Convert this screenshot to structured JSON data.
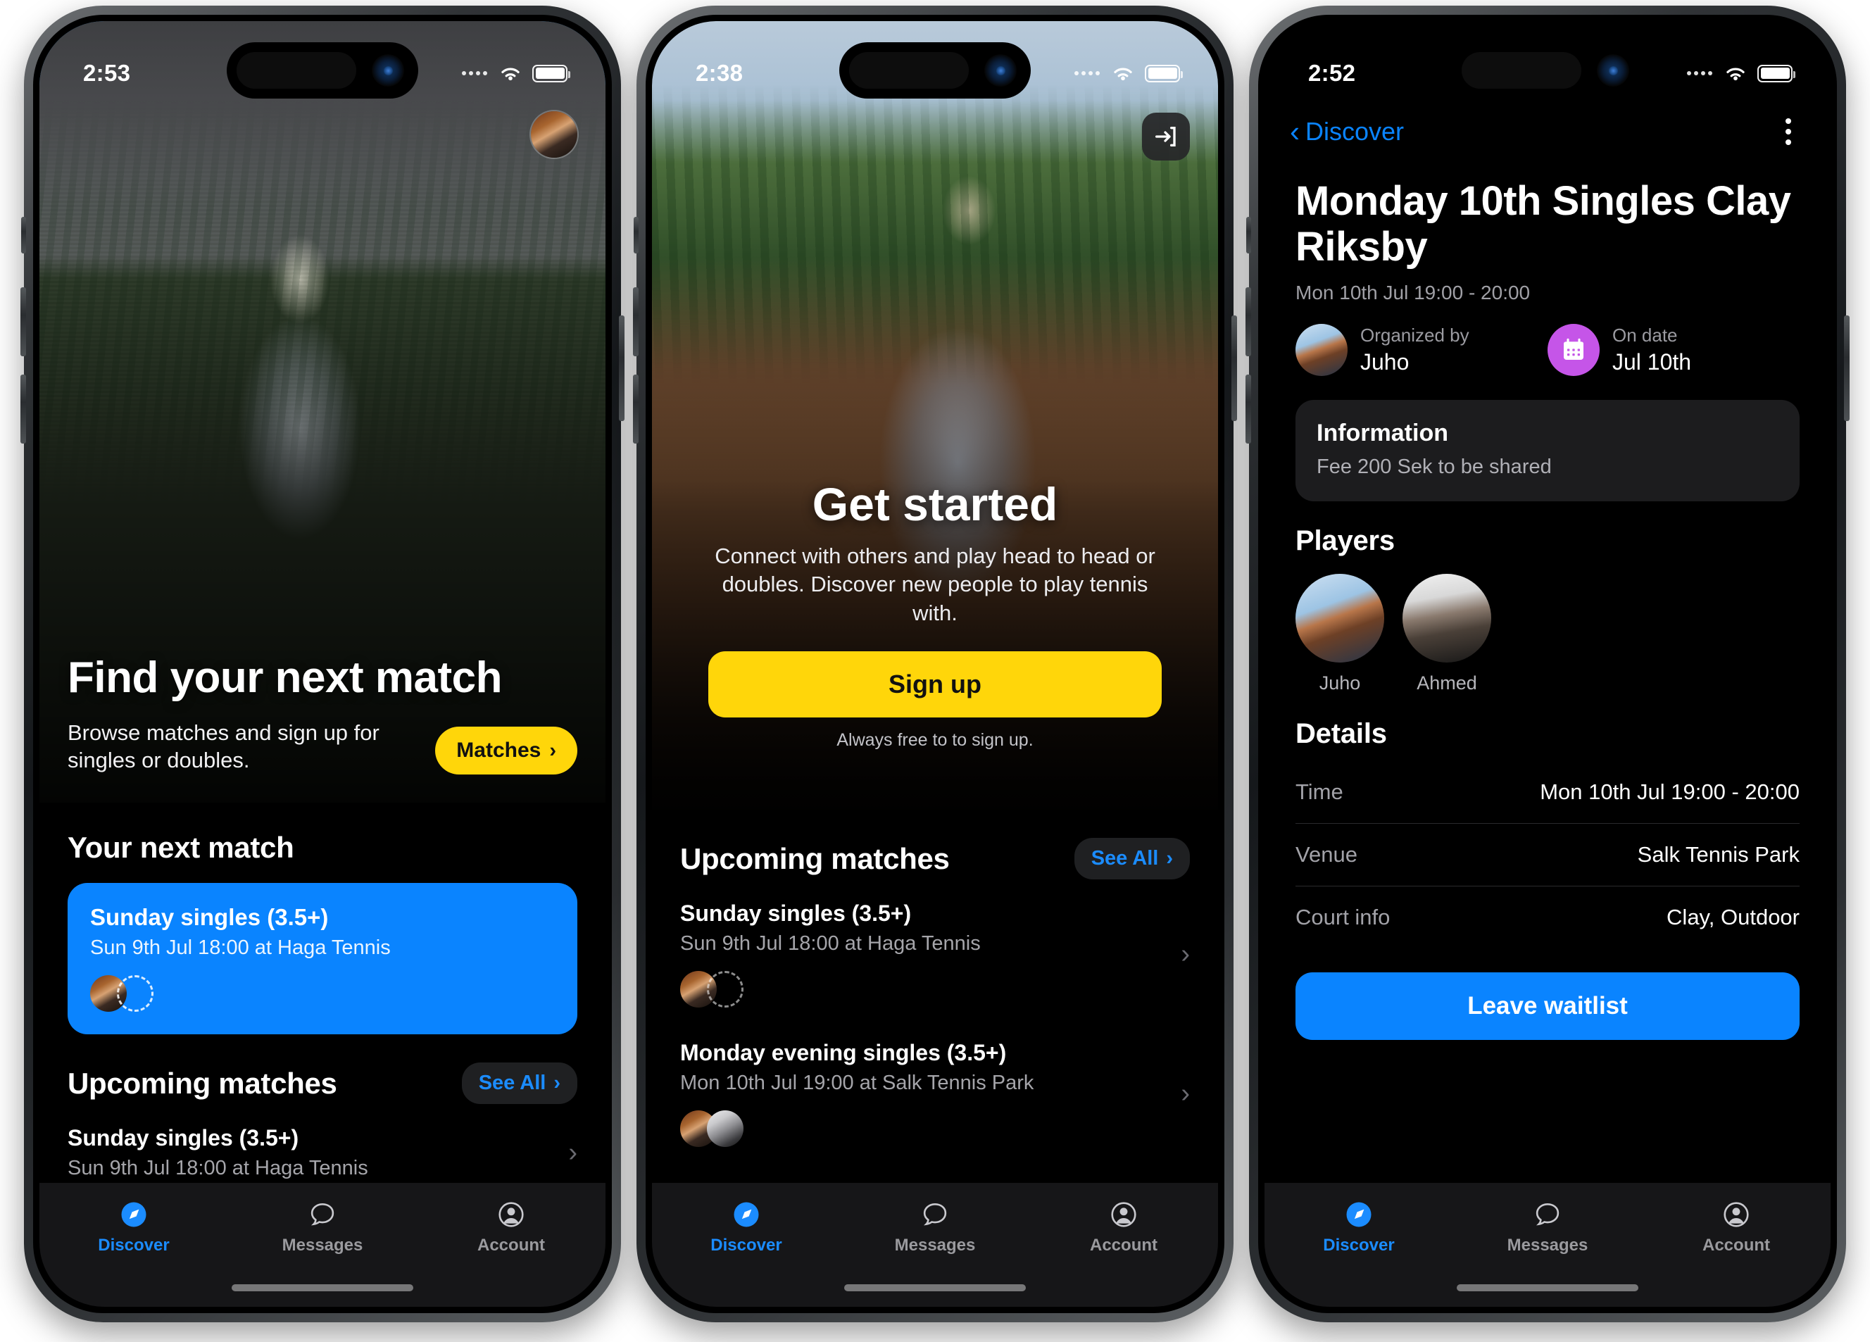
{
  "app": {
    "accent_blue": "#0a84ff",
    "accent_yellow": "#FFD60A",
    "accent_purple": "#C555E8",
    "background": "#000000"
  },
  "tabs": [
    {
      "label": "Discover",
      "icon": "compass-icon",
      "active": true
    },
    {
      "label": "Messages",
      "icon": "chat-bubble-icon",
      "active": false
    },
    {
      "label": "Account",
      "icon": "person-circle-icon",
      "active": false
    }
  ],
  "phone1": {
    "status": {
      "time": "2:53",
      "wifi": "wifi-icon",
      "battery": "battery-icon"
    },
    "avatar_name": "profile-avatar",
    "hero": {
      "title": "Find your next match",
      "subtitle": "Browse matches and sign up for singles or doubles.",
      "cta_label": "Matches",
      "cta_chevron": "›"
    },
    "next_match_heading": "Your next match",
    "next_match": {
      "title": "Sunday singles (3.5+)",
      "subtitle": "Sun 9th Jul 18:00 at Haga Tennis",
      "players_filled": 1,
      "players_empty": 1
    },
    "upcoming_heading": "Upcoming matches",
    "see_all_label": "See All",
    "see_all_chevron": "›",
    "upcoming": [
      {
        "title": "Sunday singles (3.5+)",
        "subtitle": "Sun 9th Jul 18:00 at Haga Tennis",
        "chevron": "›"
      }
    ]
  },
  "phone2": {
    "status": {
      "time": "2:38",
      "wifi": "wifi-icon",
      "battery": "battery-icon"
    },
    "signin_icon": "sign-in-icon",
    "hero": {
      "title": "Get started",
      "subtitle": "Connect with others and play head to head or doubles. Discover new people to play tennis with.",
      "cta_label": "Sign up",
      "free_note": "Always free to to sign up."
    },
    "upcoming_heading": "Upcoming matches",
    "see_all_label": "See All",
    "see_all_chevron": "›",
    "upcoming": [
      {
        "title": "Sunday singles (3.5+)",
        "subtitle": "Sun 9th Jul 18:00 at Haga Tennis",
        "chevron": "›",
        "players_filled": 1,
        "players_empty": 1
      },
      {
        "title": "Monday evening singles (3.5+)",
        "subtitle": "Mon 10th Jul 19:00 at Salk Tennis Park",
        "chevron": "›",
        "players_filled": 2,
        "players_empty": 0
      }
    ]
  },
  "phone3": {
    "status": {
      "time": "2:52",
      "wifi": "wifi-icon",
      "battery": "battery-icon"
    },
    "nav": {
      "back_label": "Discover",
      "back_chevron": "‹",
      "menu_icon": "kebab-menu-icon"
    },
    "title": "Monday 10th  Singles Clay Riksby",
    "date_line": "Mon 10th Jul 19:00 - 20:00",
    "meta": [
      {
        "label": "Organized by",
        "value": "Juho",
        "icon": "organizer-avatar"
      },
      {
        "label": "On date",
        "value": "Jul 10th",
        "icon": "calendar-icon"
      }
    ],
    "information": {
      "heading": "Information",
      "text": "Fee 200 Sek to be shared"
    },
    "players_heading": "Players",
    "players": [
      {
        "name": "Juho"
      },
      {
        "name": "Ahmed"
      }
    ],
    "details_heading": "Details",
    "details": [
      {
        "key": "Time",
        "value": "Mon 10th Jul 19:00 - 20:00"
      },
      {
        "key": "Venue",
        "value": "Salk Tennis Park"
      },
      {
        "key": "Court info",
        "value": "Clay, Outdoor"
      }
    ],
    "action_label": "Leave waitlist"
  }
}
